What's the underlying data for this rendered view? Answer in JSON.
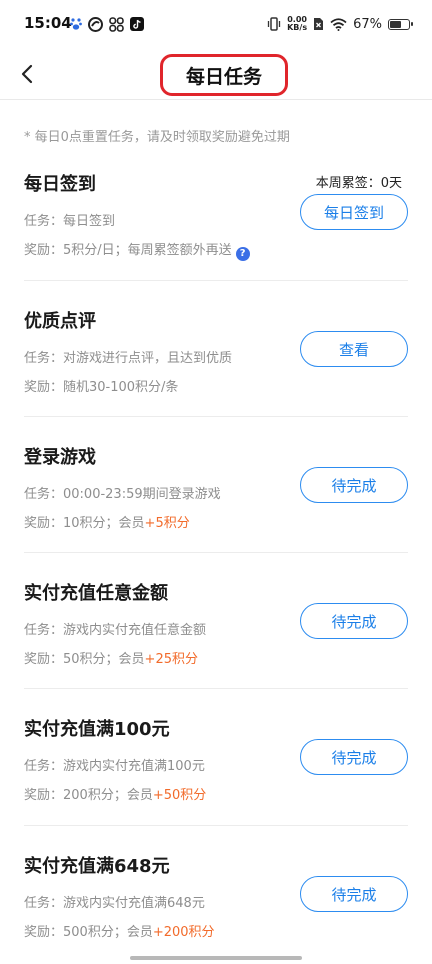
{
  "status_bar": {
    "time": "15:04",
    "net_speed_value": "0.00",
    "net_speed_unit": "KB/s",
    "battery": "67%",
    "battery_level": 0.67
  },
  "header": {
    "title": "每日任务"
  },
  "notice": "* 每日0点重置任务，请及时领取奖励避免过期",
  "tasks": [
    {
      "title": "每日签到",
      "weekly": "本周累签：0天",
      "task_text": "任务：每日签到",
      "reward_text": "奖励：5积分/日；每周累签额外再送",
      "bonus": "",
      "button": "每日签到"
    },
    {
      "title": "优质点评",
      "task_text": "任务：对游戏进行点评，且达到优质",
      "reward_text": "奖励：随机30-100积分/条",
      "bonus": "",
      "button": "查看"
    },
    {
      "title": "登录游戏",
      "task_text": "任务：00:00-23:59期间登录游戏",
      "reward_text": "奖励：10积分；会员",
      "bonus": "+5积分",
      "button": "待完成"
    },
    {
      "title": "实付充值任意金额",
      "task_text": "任务：游戏内实付充值任意金额",
      "reward_text": "奖励：50积分；会员",
      "bonus": "+25积分",
      "button": "待完成"
    },
    {
      "title": "实付充值满100元",
      "task_text": "任务：游戏内实付充值满100元",
      "reward_text": "奖励：200积分；会员",
      "bonus": "+50积分",
      "button": "待完成"
    },
    {
      "title": "实付充值满648元",
      "task_text": "任务：游戏内实付充值满648元",
      "reward_text": "奖励：500积分；会员",
      "bonus": "+200积分",
      "button": "待完成"
    }
  ],
  "colors": {
    "accent_blue": "#2d8cf0",
    "bonus_orange": "#f26b2b",
    "highlight_red": "#e0252b"
  }
}
